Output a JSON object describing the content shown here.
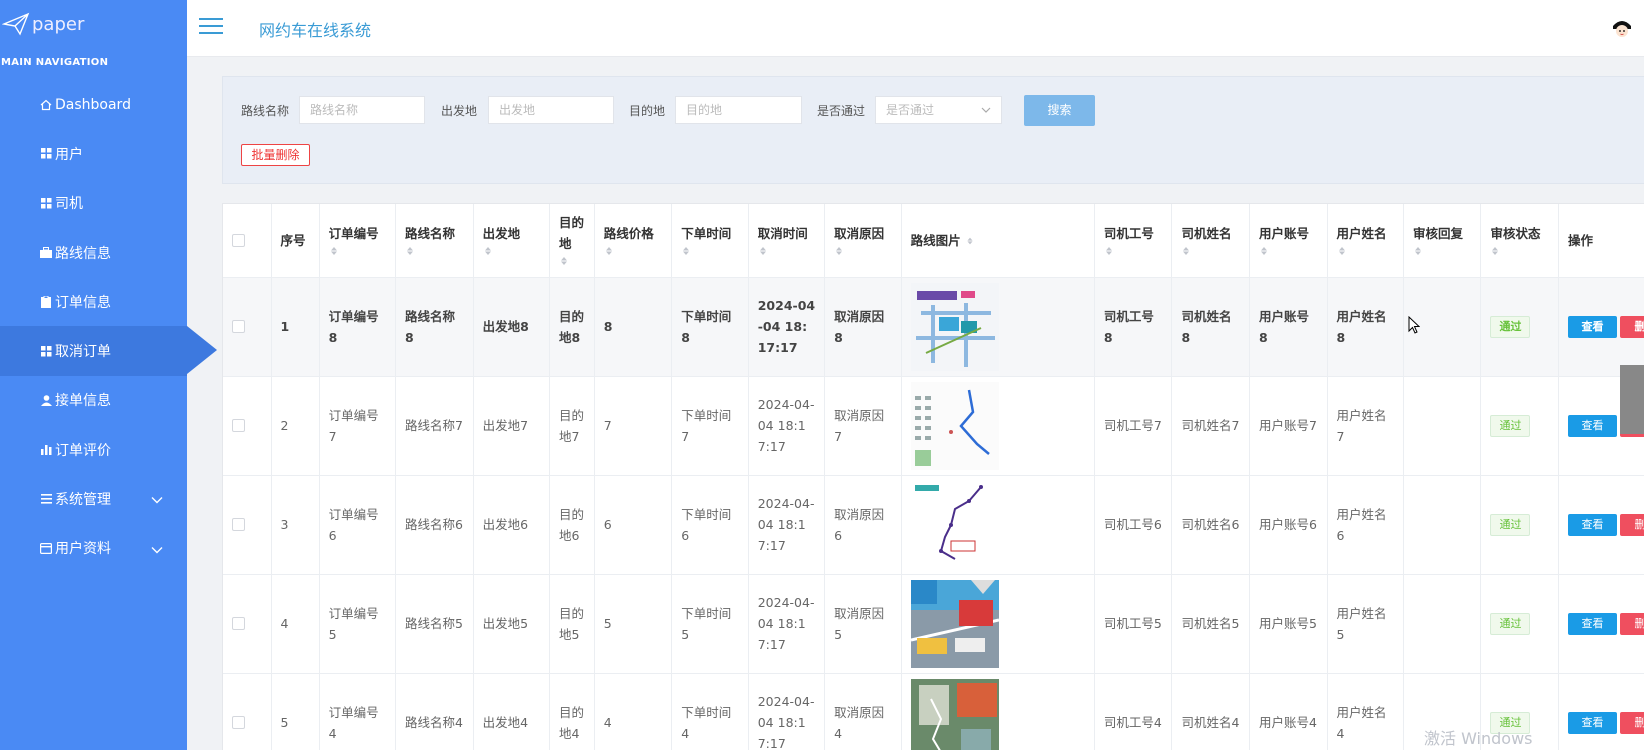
{
  "brand": {
    "name": "paper"
  },
  "sidebar": {
    "section_title": "MAIN NAVIGATION",
    "items": [
      {
        "label": "Dashboard",
        "icon": "home-icon"
      },
      {
        "label": "用户",
        "icon": "grid-icon"
      },
      {
        "label": "司机",
        "icon": "grid-icon"
      },
      {
        "label": "路线信息",
        "icon": "briefcase-icon"
      },
      {
        "label": "订单信息",
        "icon": "clipboard-icon"
      },
      {
        "label": "取消订单",
        "icon": "grid-icon",
        "active": true
      },
      {
        "label": "接单信息",
        "icon": "user-icon"
      },
      {
        "label": "订单评价",
        "icon": "bar-chart-icon"
      },
      {
        "label": "系统管理",
        "icon": "list-icon",
        "expandable": true
      },
      {
        "label": "用户资料",
        "icon": "card-icon",
        "expandable": true
      }
    ]
  },
  "header": {
    "title": "网约车在线系统"
  },
  "search": {
    "route_name_label": "路线名称",
    "route_name_placeholder": "路线名称",
    "from_label": "出发地",
    "from_placeholder": "出发地",
    "to_label": "目的地",
    "to_placeholder": "目的地",
    "approved_label": "是否通过",
    "approved_placeholder": "是否通过",
    "search_button": "搜索",
    "batch_delete_button": "批量删除"
  },
  "table": {
    "columns": [
      "序号",
      "订单编号",
      "路线名称",
      "出发地",
      "目的地",
      "路线价格",
      "下单时间",
      "取消时间",
      "取消原因",
      "路线图片",
      "司机工号",
      "司机姓名",
      "用户账号",
      "用户姓名",
      "审核回复",
      "审核状态",
      "操作"
    ],
    "view_label": "查看",
    "delete_label": "删除",
    "rows": [
      {
        "idx": "1",
        "order_no": "订单编号8",
        "route": "路线名称8",
        "from": "出发地8",
        "to": "目的地8",
        "price": "8",
        "order_time": "下单时间8",
        "cancel_time": "2024-04-04 18:17:17",
        "reason": "取消原因8",
        "driver_no": "司机工号8",
        "driver_name": "司机姓名8",
        "user_acc": "用户账号8",
        "user_name": "用户姓名8",
        "reply": "",
        "status": "通过"
      },
      {
        "idx": "2",
        "order_no": "订单编号7",
        "route": "路线名称7",
        "from": "出发地7",
        "to": "目的地7",
        "price": "7",
        "order_time": "下单时间7",
        "cancel_time": "2024-04-04 18:17:17",
        "reason": "取消原因7",
        "driver_no": "司机工号7",
        "driver_name": "司机姓名7",
        "user_acc": "用户账号7",
        "user_name": "用户姓名7",
        "reply": "",
        "status": "通过"
      },
      {
        "idx": "3",
        "order_no": "订单编号6",
        "route": "路线名称6",
        "from": "出发地6",
        "to": "目的地6",
        "price": "6",
        "order_time": "下单时间6",
        "cancel_time": "2024-04-04 18:17:17",
        "reason": "取消原因6",
        "driver_no": "司机工号6",
        "driver_name": "司机姓名6",
        "user_acc": "用户账号6",
        "user_name": "用户姓名6",
        "reply": "",
        "status": "通过"
      },
      {
        "idx": "4",
        "order_no": "订单编号5",
        "route": "路线名称5",
        "from": "出发地5",
        "to": "目的地5",
        "price": "5",
        "order_time": "下单时间5",
        "cancel_time": "2024-04-04 18:17:17",
        "reason": "取消原因5",
        "driver_no": "司机工号5",
        "driver_name": "司机姓名5",
        "user_acc": "用户账号5",
        "user_name": "用户姓名5",
        "reply": "",
        "status": "通过"
      },
      {
        "idx": "5",
        "order_no": "订单编号4",
        "route": "路线名称4",
        "from": "出发地4",
        "to": "目的地4",
        "price": "4",
        "order_time": "下单时间4",
        "cancel_time": "2024-04-04 18:17:17",
        "reason": "取消原因4",
        "driver_no": "司机工号4",
        "driver_name": "司机姓名4",
        "user_acc": "用户账号4",
        "user_name": "用户姓名4",
        "reply": "",
        "status": "通过"
      }
    ]
  },
  "watermark": "激活 Windows",
  "colors": {
    "sidebar": "#4a8af4",
    "sidebar_active": "#3d79df",
    "accent": "#3a9bd5",
    "view_button": "#1a9be6",
    "delete_button": "#ef4f5f",
    "status_pass": "#67c23a"
  }
}
